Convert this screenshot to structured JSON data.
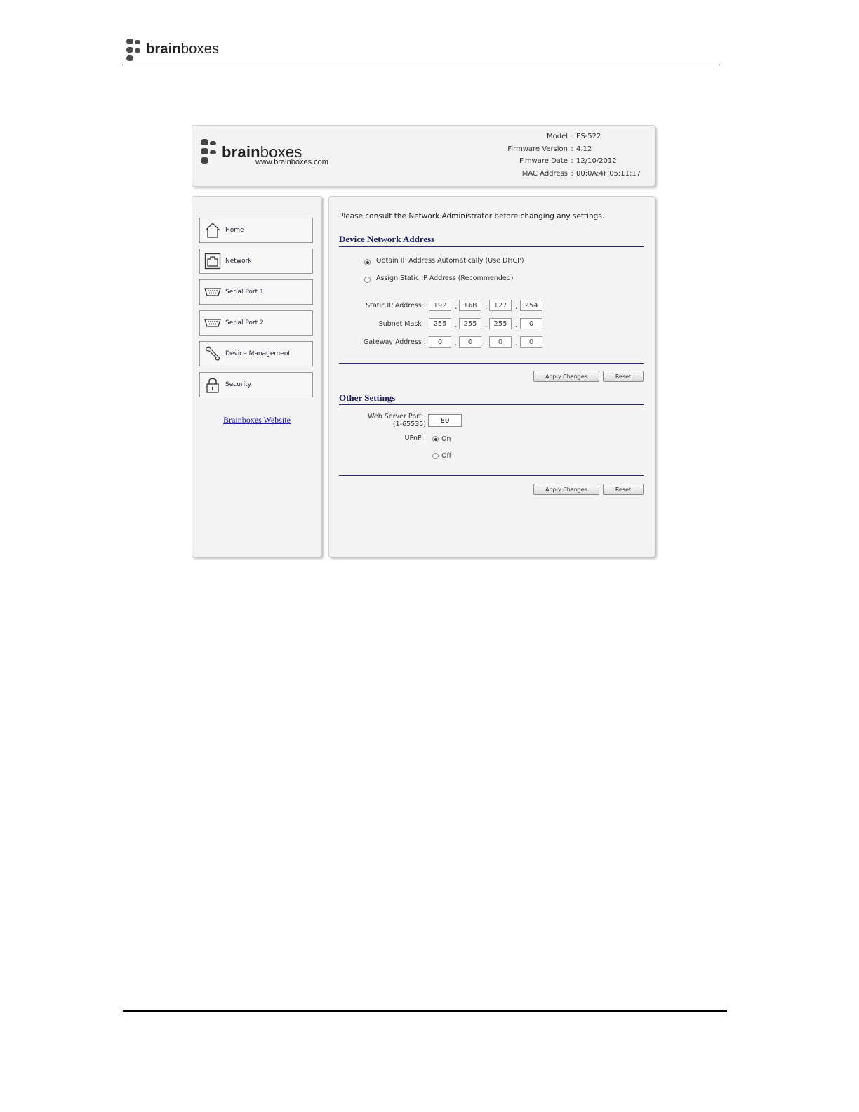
{
  "doc_header": {
    "logo_bold": "brain",
    "logo_light": "boxes"
  },
  "ui_header": {
    "logo_bold": "brain",
    "logo_light": "boxes",
    "url": "www.brainboxes.com",
    "info": [
      {
        "label": "Model",
        "value": "ES-522"
      },
      {
        "label": "Firmware Version",
        "value": "4.12"
      },
      {
        "label": "Fimware Date",
        "value": "12/10/2012"
      },
      {
        "label": "MAC Address",
        "value": "00:0A:4F:05:11:17"
      }
    ]
  },
  "nav": {
    "items": [
      {
        "label": "Home",
        "icon": "home-icon"
      },
      {
        "label": "Network",
        "icon": "network-icon"
      },
      {
        "label": "Serial Port 1",
        "icon": "serial-port-icon"
      },
      {
        "label": "Serial Port 2",
        "icon": "serial-port-icon"
      },
      {
        "label": "Device Management",
        "icon": "wrench-icon"
      },
      {
        "label": "Security",
        "icon": "lock-icon"
      }
    ],
    "website_link": "Brainboxes Website"
  },
  "main": {
    "consult_text": "Please consult the Network Administrator before changing any settings.",
    "network_section": {
      "title": "Device Network Address",
      "dhcp_label": "Obtain IP Address Automatically (Use DHCP)",
      "static_label": "Assign Static IP Address (Recommended)",
      "selected": "dhcp",
      "static_ip_label": "Static IP Address :",
      "subnet_label": "Subnet Mask :",
      "gateway_label": "Gateway Address :",
      "static_ip": [
        "192",
        "168",
        "127",
        "254"
      ],
      "subnet": [
        "255",
        "255",
        "255",
        "0"
      ],
      "gateway": [
        "0",
        "0",
        "0",
        "0"
      ],
      "apply_label": "Apply Changes",
      "reset_label": "Reset"
    },
    "other_section": {
      "title": "Other Settings",
      "port_label": "Web Server Port :",
      "port_range": "(1-65535)",
      "port_value": "80",
      "upnp_label": "UPnP :",
      "on_label": "On",
      "off_label": "Off",
      "upnp_selected": "On",
      "apply_label": "Apply Changes",
      "reset_label": "Reset"
    }
  }
}
